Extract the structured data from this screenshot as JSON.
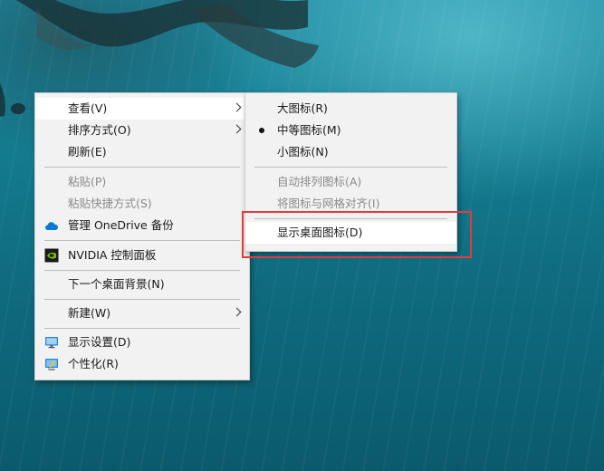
{
  "context_menu": {
    "items": [
      {
        "label": "查看(V)",
        "has_submenu": true,
        "highlighted": true
      },
      {
        "label": "排序方式(O)",
        "has_submenu": true
      },
      {
        "label": "刷新(E)"
      },
      {
        "label": "粘贴(P)",
        "disabled": true
      },
      {
        "label": "粘贴快捷方式(S)",
        "disabled": true
      },
      {
        "label": "管理 OneDrive 备份",
        "icon": "onedrive-cloud-icon"
      },
      {
        "label": "NVIDIA 控制面板",
        "icon": "nvidia-icon"
      },
      {
        "label": "下一个桌面背景(N)"
      },
      {
        "label": "新建(W)",
        "has_submenu": true
      },
      {
        "label": "显示设置(D)",
        "icon": "display-settings-icon"
      },
      {
        "label": "个性化(R)",
        "icon": "personalize-icon"
      }
    ]
  },
  "view_submenu": {
    "items": [
      {
        "label": "大图标(R)"
      },
      {
        "label": "中等图标(M)",
        "selected": true
      },
      {
        "label": "小图标(N)"
      },
      {
        "label": "自动排列图标(A)",
        "disabled": true
      },
      {
        "label": "将图标与网格对齐(I)",
        "disabled": true
      },
      {
        "label": "显示桌面图标(D)",
        "highlighted": true
      }
    ]
  },
  "colors": {
    "menu_background": "#f2f2f2",
    "hover_background": "#ffffff",
    "disabled_text": "#8a8a8a",
    "annotation_red": "#e23b3b",
    "onedrive_blue": "#0a78d4",
    "nvidia_green": "#76b900"
  }
}
